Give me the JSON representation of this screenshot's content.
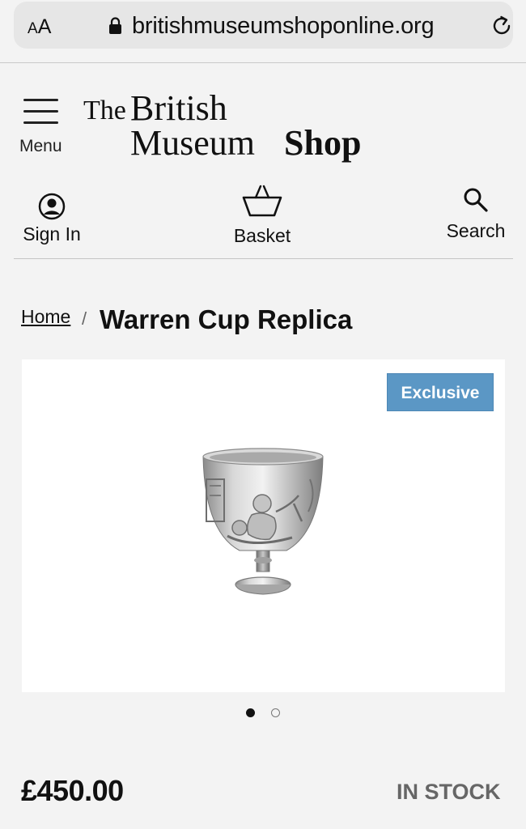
{
  "browser": {
    "text_size_label_small": "A",
    "text_size_label_large": "A",
    "url": "britishmuseumshoponline.org"
  },
  "header": {
    "menu_label": "Menu",
    "logo": {
      "the": "The",
      "british": "British",
      "museum": "Museum",
      "shop": "Shop"
    },
    "sign_in_label": "Sign In",
    "basket_label": "Basket",
    "search_label": "Search"
  },
  "breadcrumb": {
    "home": "Home",
    "separator": "/",
    "current": "Warren Cup Replica"
  },
  "product": {
    "badge": "Exclusive",
    "badge_color": "#5b97c5",
    "image_count": 2,
    "active_image": 1,
    "price": "£450.00",
    "stock": "IN STOCK"
  },
  "icons": [
    "lock-icon",
    "reload-icon",
    "menu-icon",
    "user-icon",
    "basket-icon",
    "search-icon"
  ]
}
